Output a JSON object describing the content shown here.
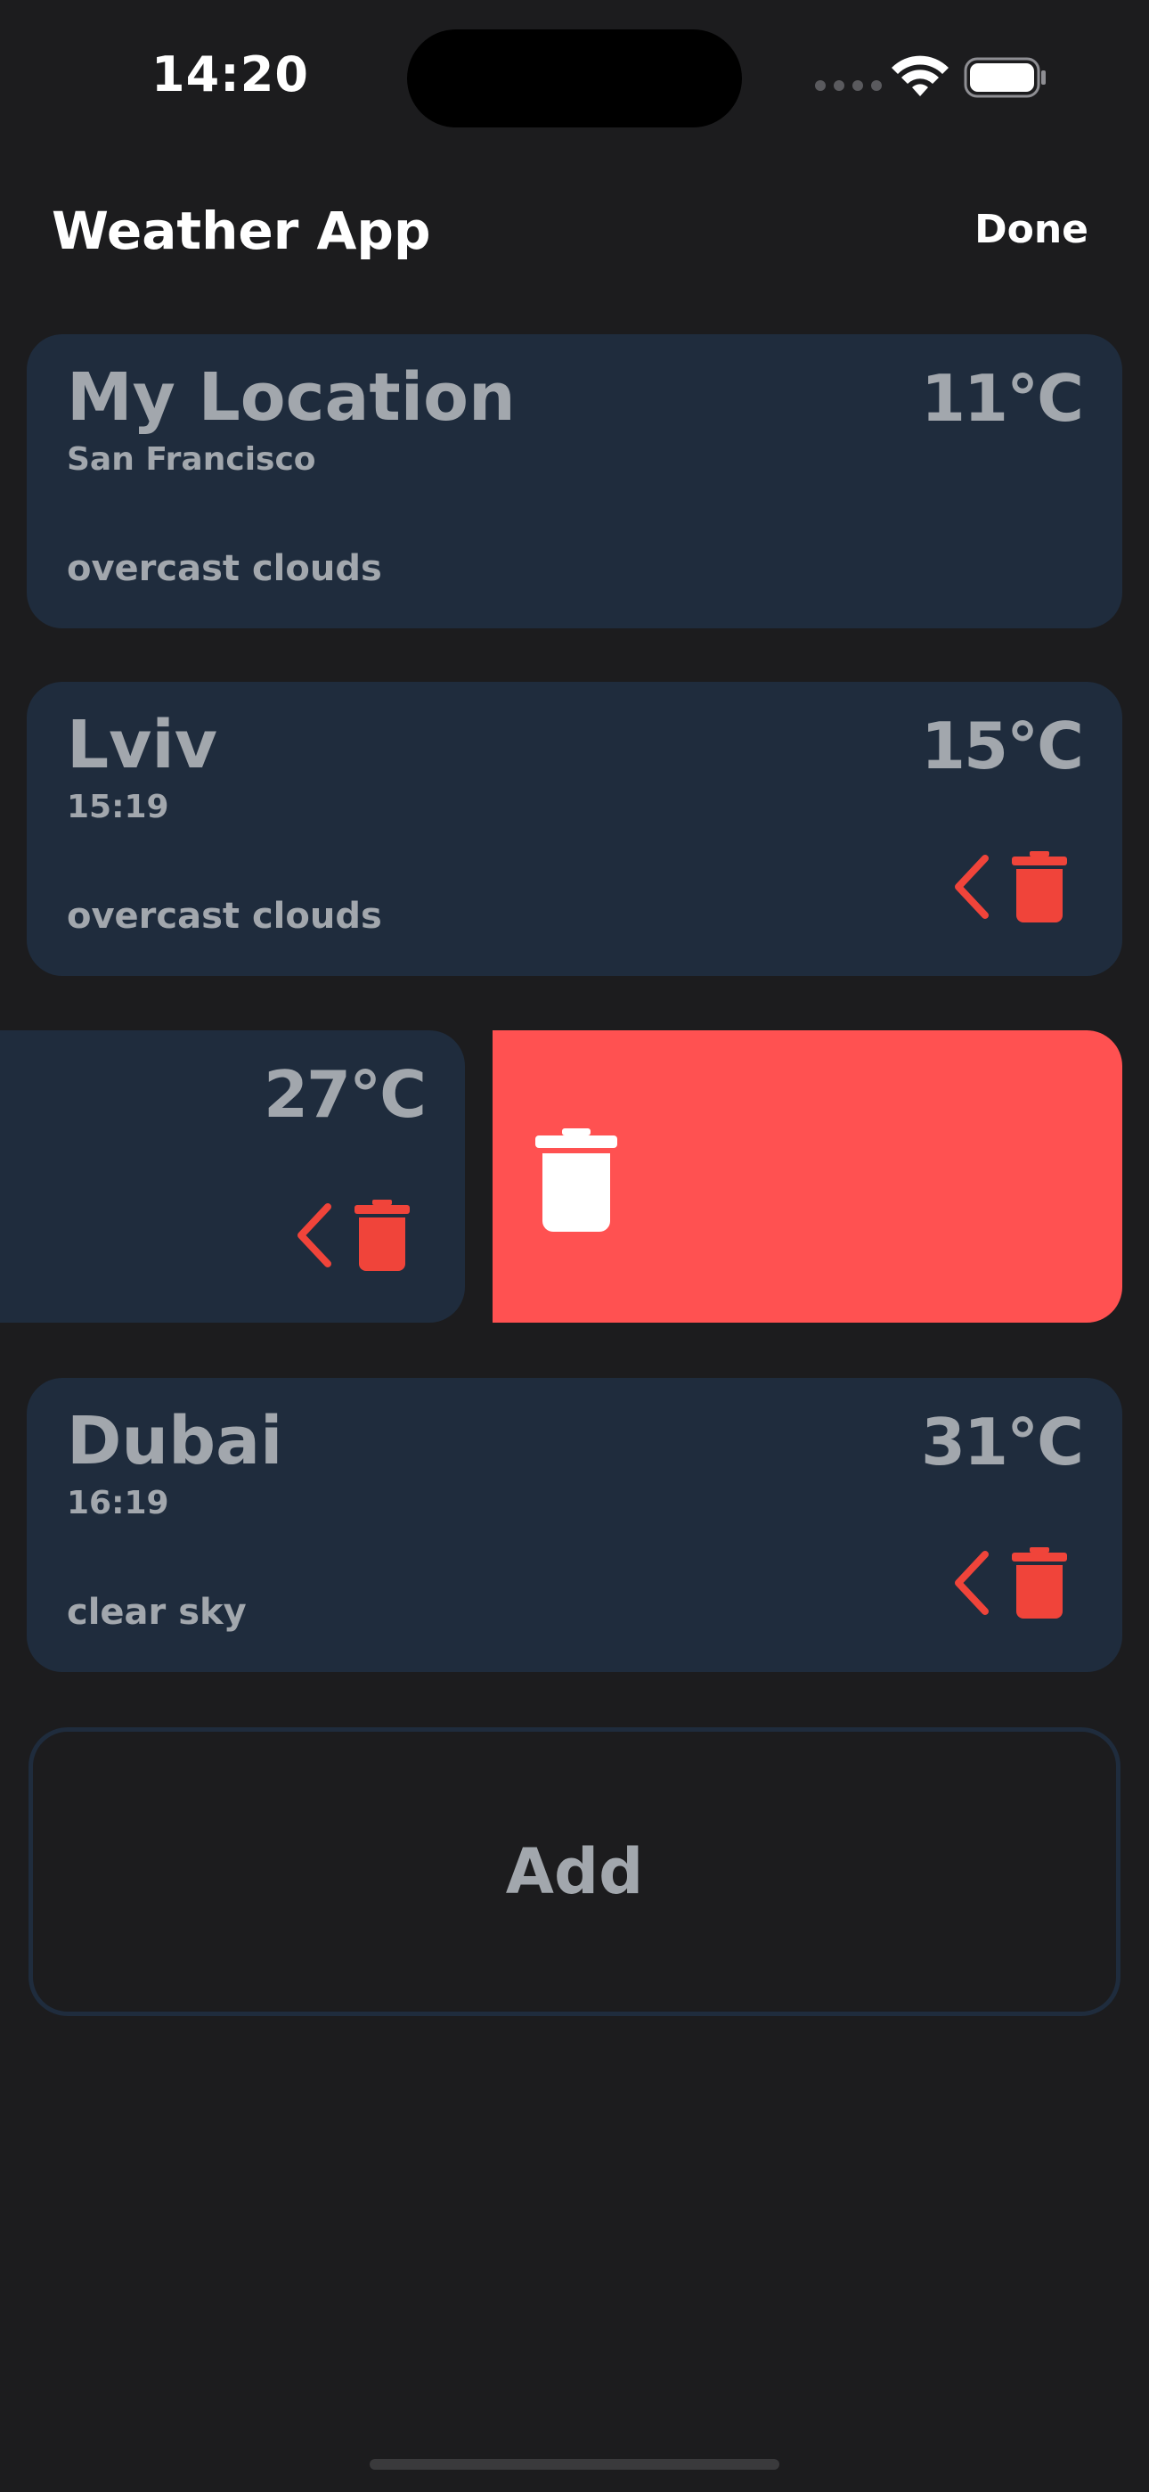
{
  "status_bar": {
    "time": "14:20",
    "icons": [
      "signal-icon",
      "wifi-icon",
      "battery-icon"
    ]
  },
  "header": {
    "title": "Weather App",
    "done_label": "Done"
  },
  "cards": [
    {
      "title": "My Location",
      "subtitle": "San Francisco",
      "description": "overcast clouds",
      "temperature": "11°C"
    },
    {
      "title": "Lviv",
      "subtitle": "15:19",
      "description": "overcast clouds",
      "temperature": "15°C"
    },
    {
      "title": "",
      "subtitle": "",
      "description": "",
      "temperature": "27°C",
      "state": "swiped"
    },
    {
      "title": "Dubai",
      "subtitle": "16:19",
      "description": "clear sky",
      "temperature": "31°C"
    }
  ],
  "add_button": {
    "label": "Add"
  },
  "colors": {
    "background": "#1c1c1e",
    "card": "#1f2c3d",
    "text_muted": "#a2a7ad",
    "delete_red": "#ff5151",
    "icon_red": "#f0443a"
  }
}
